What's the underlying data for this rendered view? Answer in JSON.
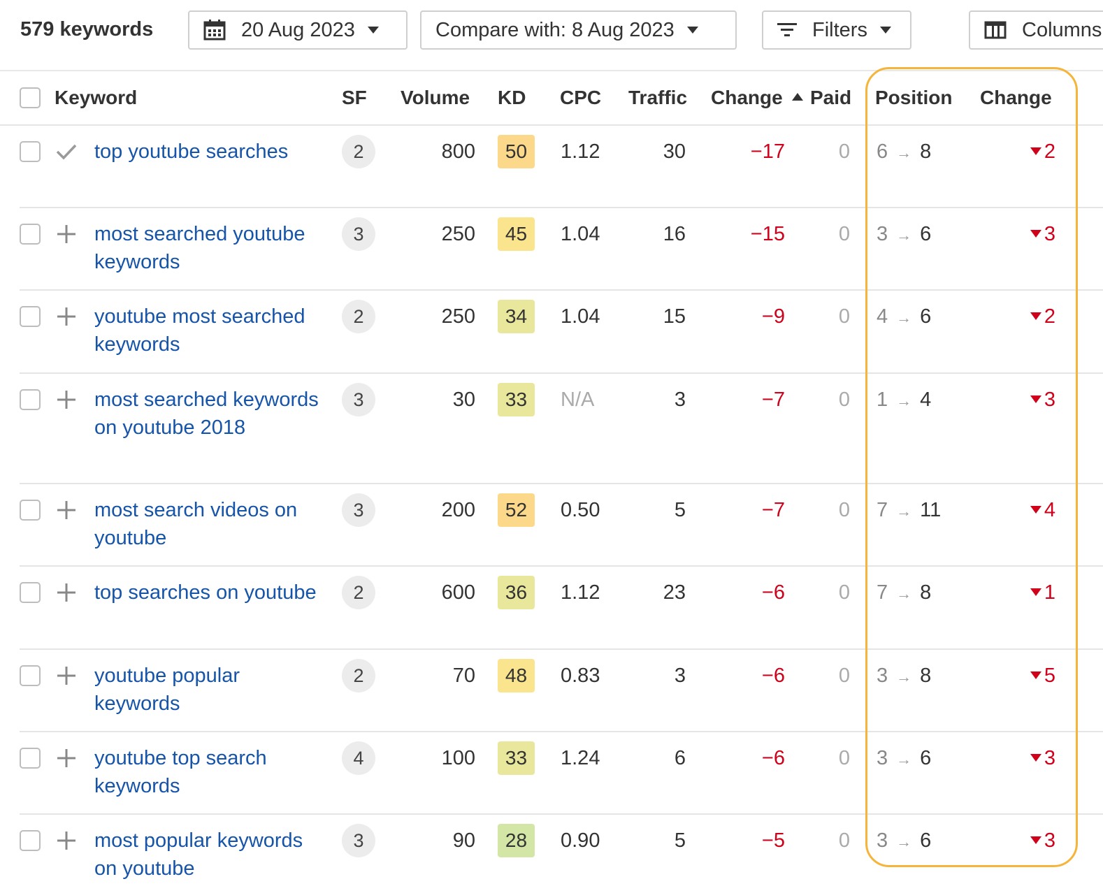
{
  "toolbar": {
    "keyword_count": "579 keywords",
    "date_label": "20 Aug 2023",
    "compare_label": "Compare with: 8 Aug 2023",
    "filters_label": "Filters",
    "columns_label": "Columns"
  },
  "table": {
    "headers": {
      "keyword": "Keyword",
      "sf": "SF",
      "volume": "Volume",
      "kd": "KD",
      "cpc": "CPC",
      "traffic": "Traffic",
      "traffic_change": "Change",
      "paid": "Paid",
      "position": "Position",
      "position_change": "Change"
    },
    "sort": {
      "column": "traffic_change",
      "direction": "ascending"
    },
    "rows": [
      {
        "keyword": "top youtube searches",
        "added": true,
        "sf": "2",
        "volume": "800",
        "kd": "50",
        "kd_color": "#fbd88a",
        "cpc": "1.12",
        "traffic": "30",
        "traffic_change": "−17",
        "paid": "0",
        "pos_from": "6",
        "pos_to": "8",
        "pos_change": "2"
      },
      {
        "keyword": "most searched youtube keywords",
        "added": false,
        "sf": "3",
        "volume": "250",
        "kd": "45",
        "kd_color": "#fbe48e",
        "cpc": "1.04",
        "traffic": "16",
        "traffic_change": "−15",
        "paid": "0",
        "pos_from": "3",
        "pos_to": "6",
        "pos_change": "3"
      },
      {
        "keyword": "youtube most searched keywords",
        "added": false,
        "sf": "2",
        "volume": "250",
        "kd": "34",
        "kd_color": "#e8e79b",
        "cpc": "1.04",
        "traffic": "15",
        "traffic_change": "−9",
        "paid": "0",
        "pos_from": "4",
        "pos_to": "6",
        "pos_change": "2"
      },
      {
        "keyword": "most searched keywords on youtube 2018",
        "added": false,
        "sf": "3",
        "volume": "30",
        "kd": "33",
        "kd_color": "#e8e79b",
        "cpc": "N/A",
        "traffic": "3",
        "traffic_change": "−7",
        "paid": "0",
        "pos_from": "1",
        "pos_to": "4",
        "pos_change": "3"
      },
      {
        "keyword": "most search videos on youtube",
        "added": false,
        "sf": "3",
        "volume": "200",
        "kd": "52",
        "kd_color": "#fbd88a",
        "cpc": "0.50",
        "traffic": "5",
        "traffic_change": "−7",
        "paid": "0",
        "pos_from": "7",
        "pos_to": "11",
        "pos_change": "4"
      },
      {
        "keyword": "top searches on youtube",
        "added": false,
        "sf": "2",
        "volume": "600",
        "kd": "36",
        "kd_color": "#e8e79b",
        "cpc": "1.12",
        "traffic": "23",
        "traffic_change": "−6",
        "paid": "0",
        "pos_from": "7",
        "pos_to": "8",
        "pos_change": "1"
      },
      {
        "keyword": "youtube popular keywords",
        "added": false,
        "sf": "2",
        "volume": "70",
        "kd": "48",
        "kd_color": "#fbe48e",
        "cpc": "0.83",
        "traffic": "3",
        "traffic_change": "−6",
        "paid": "0",
        "pos_from": "3",
        "pos_to": "8",
        "pos_change": "5"
      },
      {
        "keyword": "youtube top search keywords",
        "added": false,
        "sf": "4",
        "volume": "100",
        "kd": "33",
        "kd_color": "#e8e79b",
        "cpc": "1.24",
        "traffic": "6",
        "traffic_change": "−6",
        "paid": "0",
        "pos_from": "3",
        "pos_to": "6",
        "pos_change": "3"
      },
      {
        "keyword": "most popular keywords on youtube",
        "added": false,
        "sf": "3",
        "volume": "90",
        "kd": "28",
        "kd_color": "#d3e6a6",
        "cpc": "0.90",
        "traffic": "5",
        "traffic_change": "−5",
        "paid": "0",
        "pos_from": "3",
        "pos_to": "6",
        "pos_change": "3"
      }
    ]
  },
  "colors": {
    "link": "#1554a8",
    "negative": "#d0021b",
    "highlight_border": "#f4b53a"
  }
}
